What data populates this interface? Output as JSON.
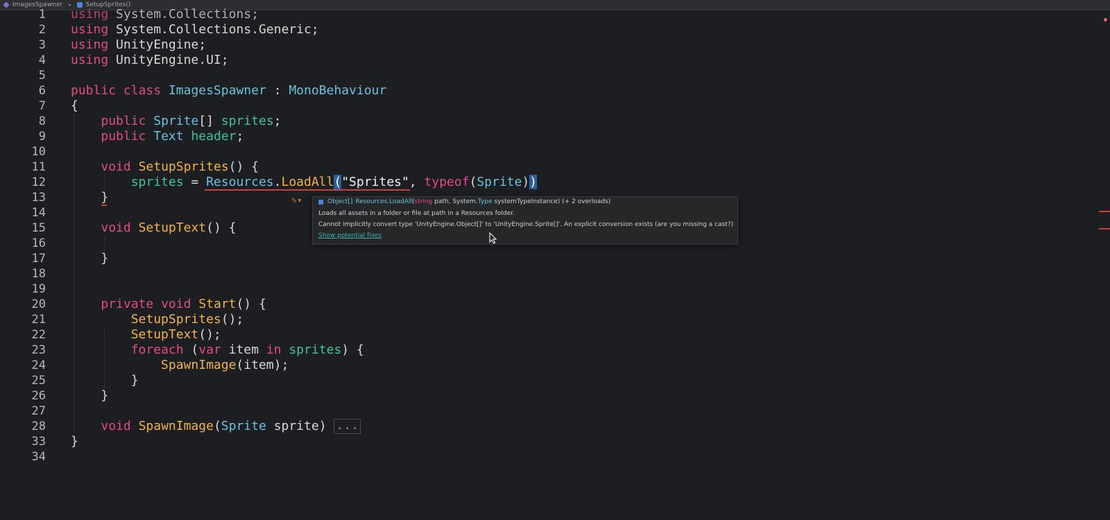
{
  "breadcrumb": {
    "items": [
      {
        "label": "ImagesSpawner",
        "icon": "class-icon"
      },
      {
        "label": "SetupSprites()",
        "icon": "method-icon"
      }
    ],
    "separator": "▸"
  },
  "editor": {
    "line_numbers": [
      "1",
      "2",
      "3",
      "4",
      "5",
      "6",
      "7",
      "8",
      "9",
      "10",
      "11",
      "12",
      "13",
      "14",
      "15",
      "16",
      "17",
      "18",
      "19",
      "20",
      "21",
      "22",
      "23",
      "24",
      "25",
      "26",
      "27",
      "28",
      "33",
      "34"
    ],
    "folded_placeholder": "..."
  },
  "tooltip": {
    "signature": {
      "return_type": "Object[]",
      "method": "Resources.LoadAll",
      "param1_type": "string",
      "param1_name": " path, ",
      "param2_ns": "System.",
      "param2_type": "Type",
      "param2_name": " systemTypeInstance) ",
      "overloads": "(+ 2 overloads)"
    },
    "description": "Loads all assets in a folder or file at path in a Resources folder.",
    "error": "Cannot implicitly convert type 'UnityEngine.Object[]' to 'UnityEngine.Sprite[]'. An explicit conversion exists (are you missing a cast?)",
    "fix_link": "Show potential fixes"
  },
  "colors": {
    "background": "#1d1e21",
    "keyword": "#e24b8d",
    "type": "#6dc1df",
    "function": "#f2b34a",
    "field": "#42c2a4",
    "error": "#d63b3b",
    "link": "#3fb0b0"
  }
}
